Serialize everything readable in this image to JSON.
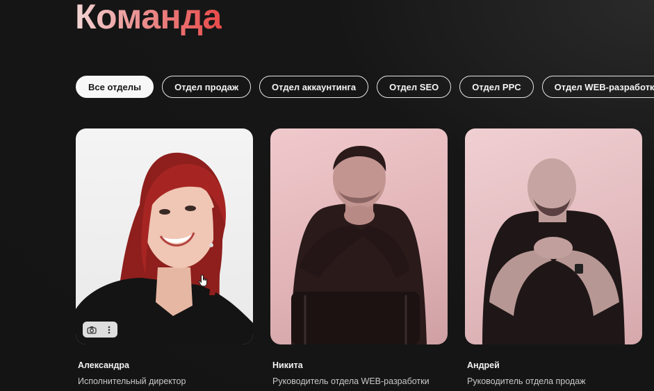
{
  "section": {
    "title": "Команда"
  },
  "filters": [
    {
      "label": "Все отделы",
      "active": true
    },
    {
      "label": "Отдел продаж",
      "active": false
    },
    {
      "label": "Отдел аккаунтинга",
      "active": false
    },
    {
      "label": "Отдел SEO",
      "active": false
    },
    {
      "label": "Отдел PPC",
      "active": false
    },
    {
      "label": "Отдел WEB-разработки",
      "active": false
    }
  ],
  "team": [
    {
      "name": "Александра",
      "role": "Исполнительный директор",
      "photo": "portrait-woman-red-hair"
    },
    {
      "name": "Никита",
      "role": "Руководитель отдела WEB-разработки",
      "photo": "portrait-man-beard-seated"
    },
    {
      "name": "Андрей",
      "role": "Руководитель отдела продаж",
      "photo": "portrait-man-bald-beard"
    }
  ],
  "photo_tools": {
    "icons": [
      "camera-search-icon",
      "more-vertical-icon"
    ]
  },
  "colors": {
    "background": "#151515",
    "title_gradient_start": "#f3d6d6",
    "title_gradient_end": "#e84a4a",
    "chip_border": "#e6e6e6",
    "active_chip_bg": "#f7f7f7"
  }
}
